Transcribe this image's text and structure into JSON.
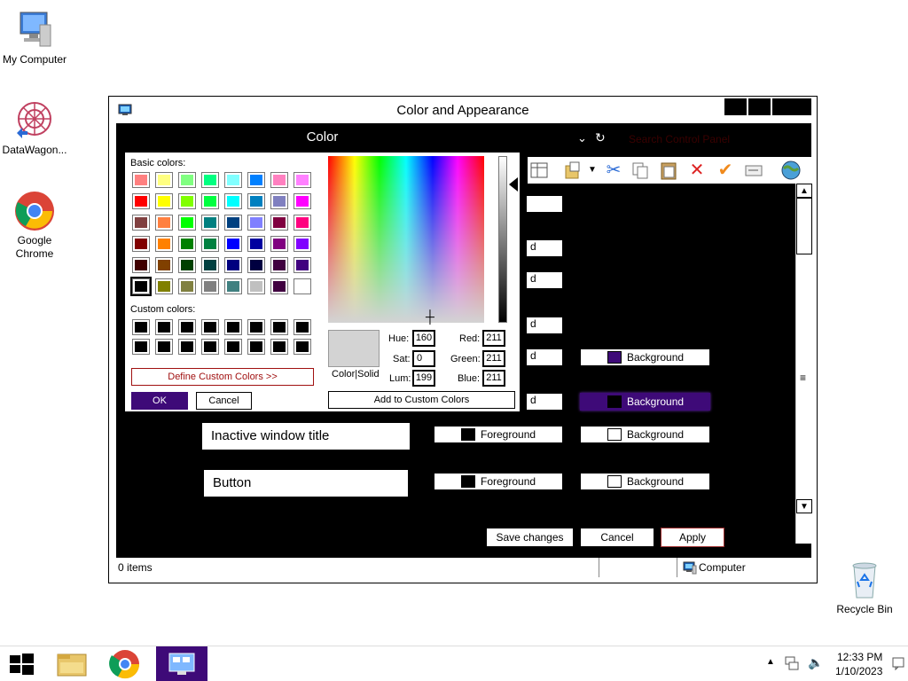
{
  "desktop": {
    "icons": [
      {
        "label": "My Computer"
      },
      {
        "label": "DataWagon..."
      },
      {
        "label": "Google\nChrome"
      },
      {
        "label": "Recycle Bin"
      }
    ]
  },
  "window": {
    "title": "Color and Appearance",
    "search_placeholder": "Search Control Panel",
    "elements": [
      {
        "name": "Inactive window title",
        "fg_label": "Foreground",
        "bg_label": "Background"
      },
      {
        "name": "Button",
        "fg_label": "Foreground",
        "bg_label": "Background"
      }
    ],
    "partial_labels": [
      "d",
      "d",
      "d",
      "d",
      "d"
    ],
    "row_bg_labels": [
      "Background",
      "Background"
    ],
    "footer": {
      "save": "Save changes",
      "cancel": "Cancel",
      "apply": "Apply"
    },
    "status": {
      "items": "0 items",
      "location": "Computer"
    },
    "colors": {
      "selected_purple": "#3e0a78",
      "black_swatch": "#000000",
      "white_swatch": "#ffffff"
    }
  },
  "color_dialog": {
    "title": "Color",
    "basic_colors_label": "Basic colors:",
    "custom_colors_label": "Custom colors:",
    "define_custom": "Define Custom Colors >>",
    "ok": "OK",
    "cancel": "Cancel",
    "add_custom": "Add to Custom Colors",
    "color_solid": "Color|Solid",
    "hue_label": "Hue:",
    "sat_label": "Sat:",
    "lum_label": "Lum:",
    "red_label": "Red:",
    "green_label": "Green:",
    "blue_label": "Blue:",
    "hue": "160",
    "sat": "0",
    "lum": "199",
    "red": "211",
    "green": "211",
    "blue": "211",
    "basic_colors": [
      [
        "#ff8080",
        "#ffff80",
        "#80ff80",
        "#00ff80",
        "#80ffff",
        "#0080ff",
        "#ff80c0",
        "#ff80ff"
      ],
      [
        "#ff0000",
        "#ffff00",
        "#80ff00",
        "#00ff40",
        "#00ffff",
        "#0080c0",
        "#8080c0",
        "#ff00ff"
      ],
      [
        "#804040",
        "#ff8040",
        "#00ff00",
        "#008080",
        "#004080",
        "#8080ff",
        "#800040",
        "#ff0080"
      ],
      [
        "#800000",
        "#ff8000",
        "#008000",
        "#008040",
        "#0000ff",
        "#0000a0",
        "#800080",
        "#8000ff"
      ],
      [
        "#400000",
        "#804000",
        "#004000",
        "#004040",
        "#000080",
        "#000040",
        "#400040",
        "#400080"
      ],
      [
        "#000000",
        "#808000",
        "#808040",
        "#808080",
        "#408080",
        "#c0c0c0",
        "#400040",
        "#ffffff"
      ]
    ]
  },
  "taskbar": {
    "time": "12:33 PM",
    "date": "1/10/2023"
  }
}
